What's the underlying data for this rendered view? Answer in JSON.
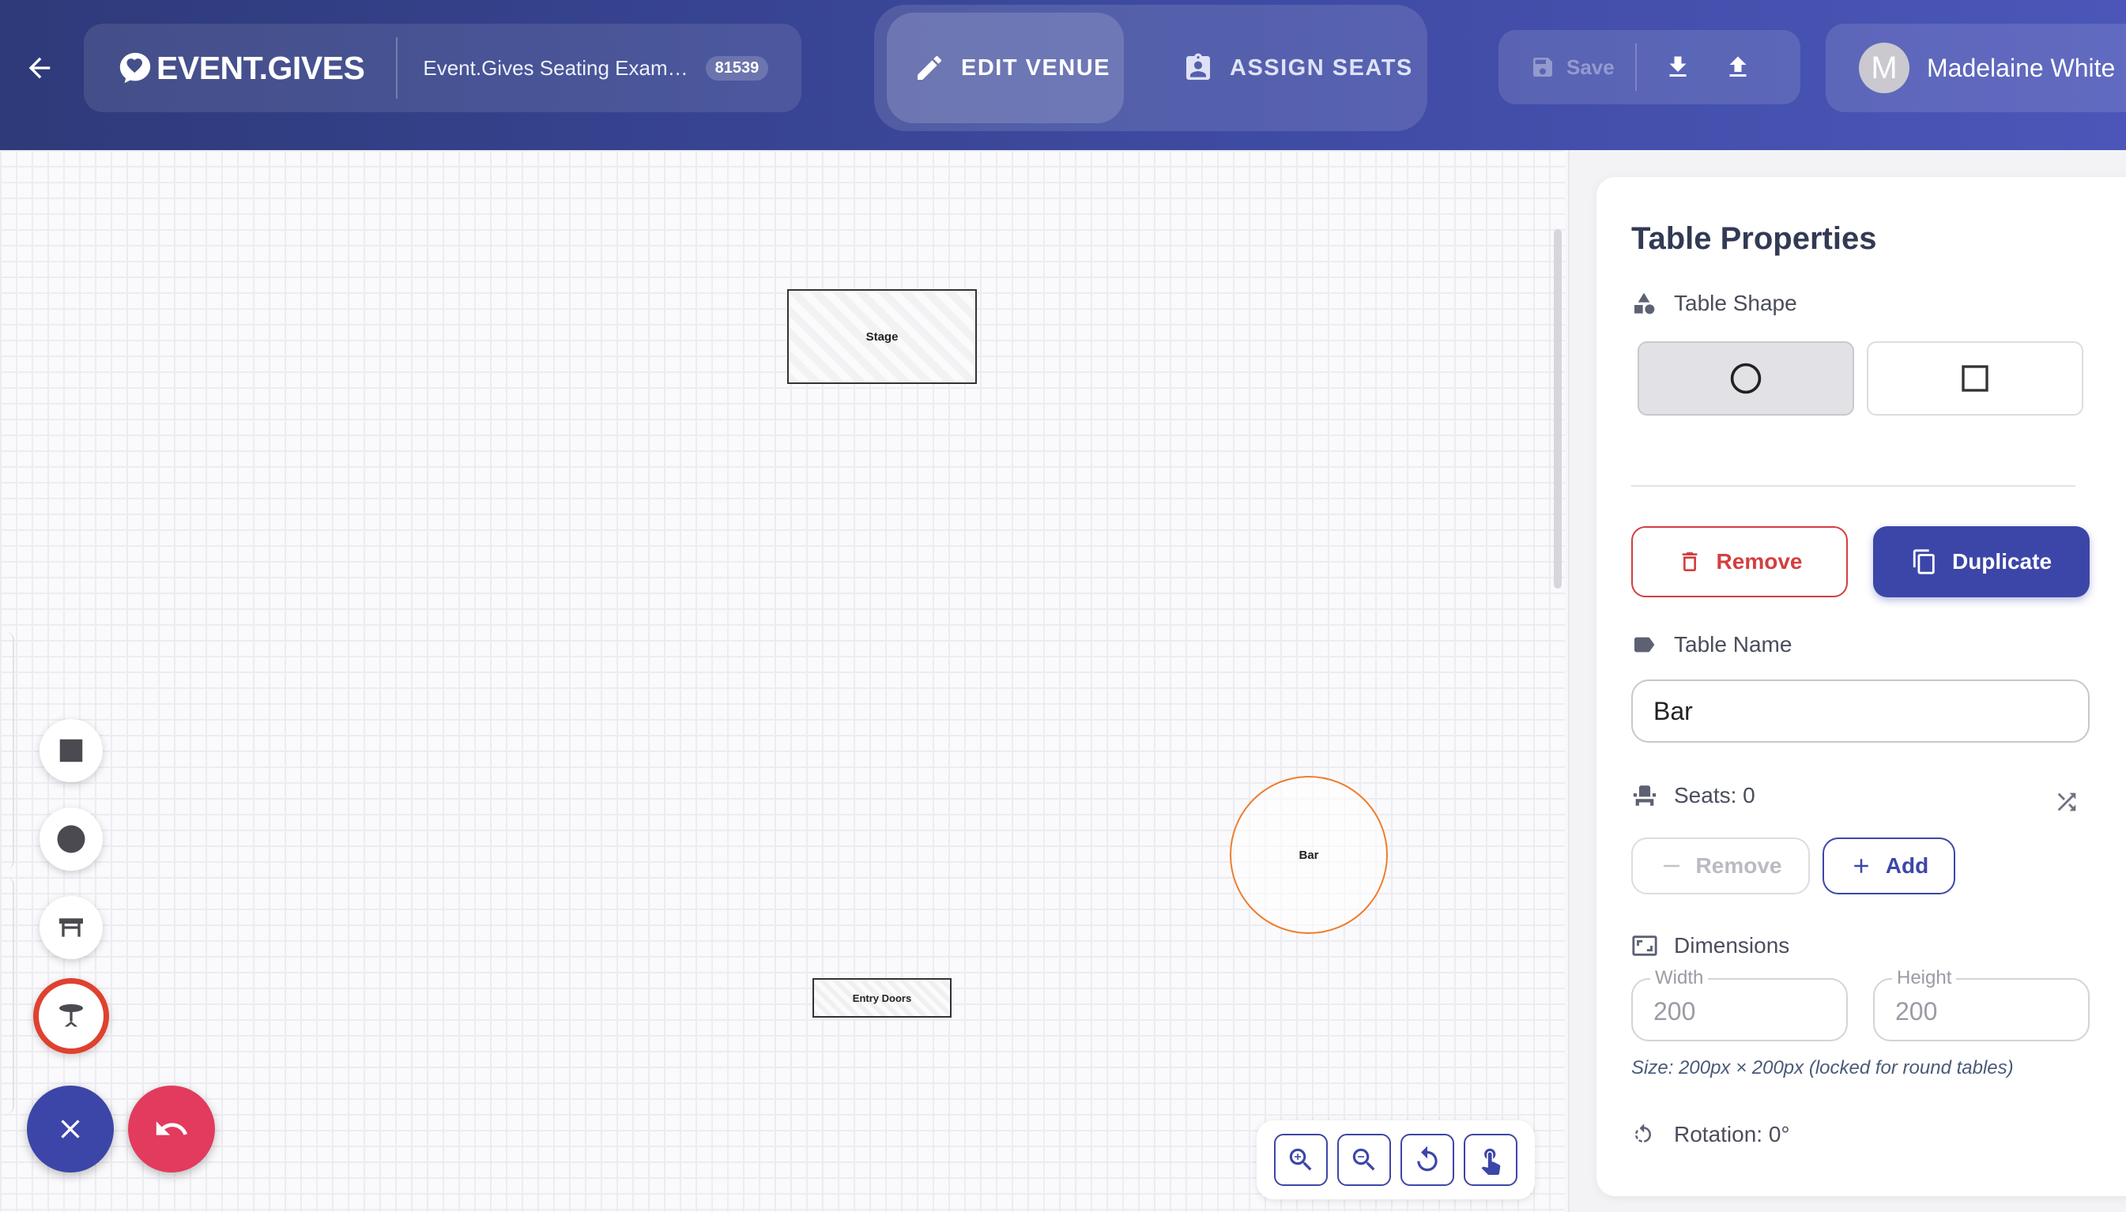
{
  "header": {
    "brand": "EVENT.GIVES",
    "event_title": "Event.Gives Seating Exam…",
    "event_id": "81539",
    "modes": [
      {
        "label": "EDIT VENUE",
        "icon": "pencil-icon",
        "active": true
      },
      {
        "label": "ASSIGN SEATS",
        "icon": "assignment-ind-icon",
        "active": false
      }
    ],
    "save_label": "Save",
    "user_initial": "M",
    "user_name": "Madelaine White"
  },
  "canvas": {
    "elements": [
      {
        "type": "rectangle",
        "label": "Stage"
      },
      {
        "type": "round-table",
        "label": "Bar",
        "selected": true
      },
      {
        "type": "rectangle",
        "label": "Entry Doors"
      }
    ],
    "tools": [
      "square-shape-icon",
      "circle-shape-icon",
      "bench-icon",
      "round-table-icon"
    ],
    "zoom_controls": [
      "zoom-in-icon",
      "zoom-out-icon",
      "reset-rotate-icon",
      "touch-pan-icon"
    ]
  },
  "properties": {
    "title": "Table Properties",
    "shape_label": "Table Shape",
    "shape_options": [
      "circle",
      "square"
    ],
    "selected_shape": "circle",
    "remove_label": "Remove",
    "duplicate_label": "Duplicate",
    "name_label": "Table Name",
    "name_value": "Bar",
    "seats_label": "Seats: 0",
    "seat_remove_label": "Remove",
    "seat_add_label": "Add",
    "dimensions_label": "Dimensions",
    "width_label": "Width",
    "width_value": "200",
    "height_label": "Height",
    "height_value": "200",
    "size_note": "Size: 200px × 200px (locked for round tables)",
    "rotation_label": "Rotation: 0°"
  },
  "colors": {
    "primary": "#3c46a8",
    "danger": "#d33f3f",
    "selection": "#f07c2c",
    "tool_selected": "#e0412f",
    "undo": "#e23b5e"
  }
}
